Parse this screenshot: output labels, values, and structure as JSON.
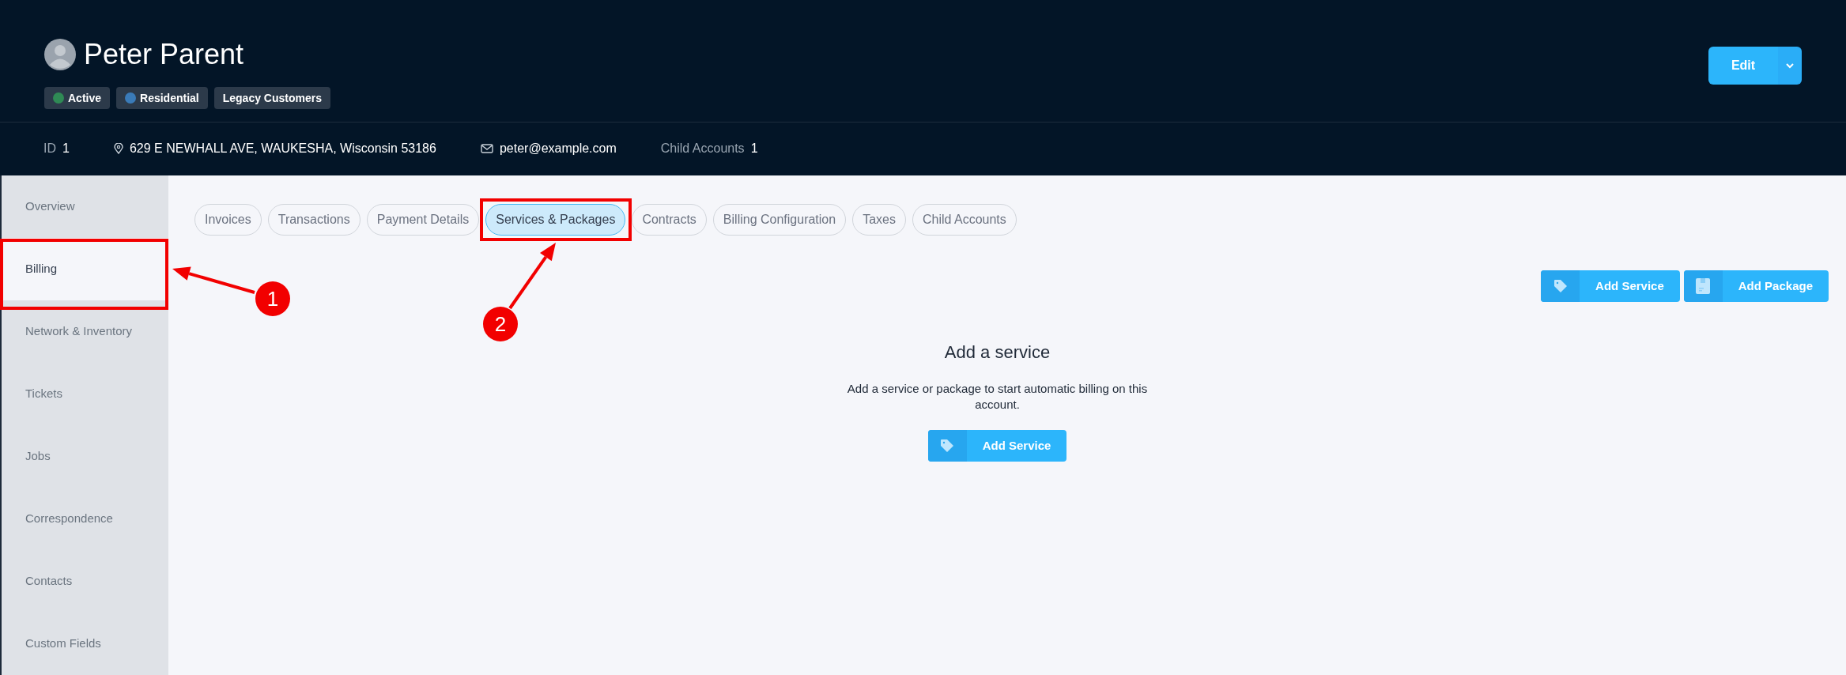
{
  "header": {
    "name": "Peter Parent",
    "badges": [
      {
        "label": "Active",
        "color": "#2f8a55"
      },
      {
        "label": "Residential",
        "color": "#3a7bb8"
      },
      {
        "label": "Legacy Customers"
      }
    ],
    "edit_button": "Edit"
  },
  "info_bar": [
    {
      "kind": "plain",
      "label": "ID",
      "value": "1"
    },
    {
      "kind": "address",
      "value": "629 E NEWHALL AVE, WAUKESHA, Wisconsin 53186"
    },
    {
      "kind": "email",
      "value": "peter@example.com"
    },
    {
      "kind": "plain",
      "label": "Child Accounts",
      "value": "1"
    }
  ],
  "sidebar": {
    "items": [
      {
        "label": "Overview",
        "selected": false
      },
      {
        "label": "Billing",
        "selected": true
      },
      {
        "label": "Network & Inventory",
        "selected": false
      },
      {
        "label": "Tickets",
        "selected": false
      },
      {
        "label": "Jobs",
        "selected": false
      },
      {
        "label": "Correspondence",
        "selected": false
      },
      {
        "label": "Contacts",
        "selected": false
      },
      {
        "label": "Custom Fields",
        "selected": false
      }
    ]
  },
  "tabs": [
    {
      "label": "Invoices",
      "selected": false
    },
    {
      "label": "Transactions",
      "selected": false
    },
    {
      "label": "Payment Details",
      "selected": false
    },
    {
      "label": "Services & Packages",
      "selected": true
    },
    {
      "label": "Contracts",
      "selected": false
    },
    {
      "label": "Billing Configuration",
      "selected": false
    },
    {
      "label": "Taxes",
      "selected": false
    },
    {
      "label": "Child Accounts",
      "selected": false
    }
  ],
  "actions": [
    {
      "kind": "service",
      "label": "Add Service"
    },
    {
      "kind": "package",
      "label": "Add Package"
    }
  ],
  "empty_state": {
    "title": "Add a service",
    "text": "Add a service or package to start automatic billing on this account.",
    "button": {
      "kind": "service",
      "label": "Add Service"
    }
  },
  "annotations": [
    {
      "number": "1"
    },
    {
      "number": "2"
    }
  ]
}
